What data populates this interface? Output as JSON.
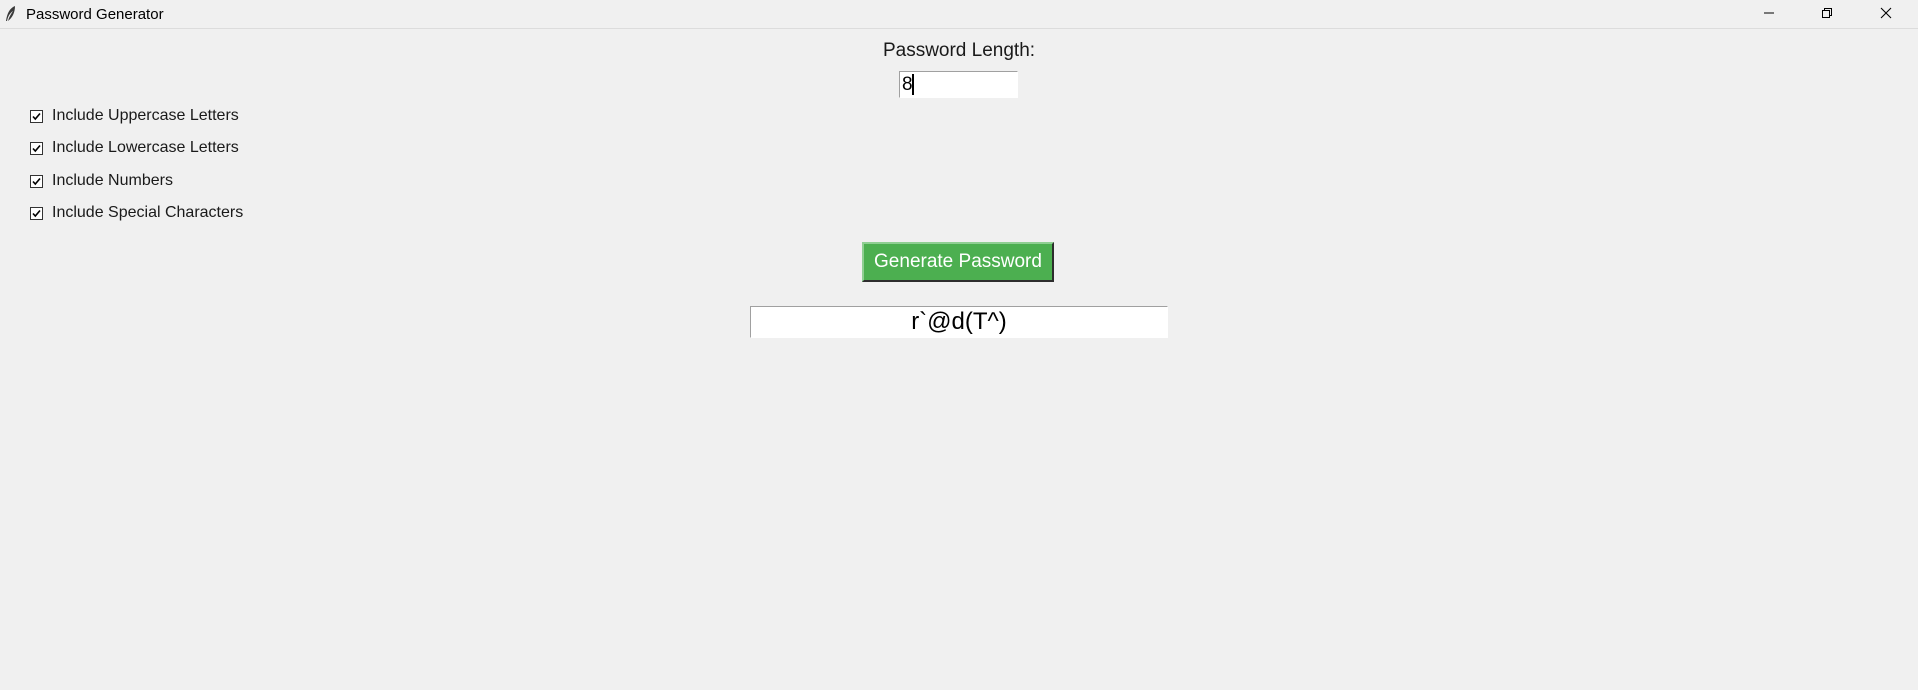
{
  "window": {
    "title": "Password Generator",
    "controls": {
      "minimize_icon": "minimize-icon",
      "maximize_icon": "restore-icon",
      "close_icon": "close-icon"
    }
  },
  "form": {
    "length_label": "Password Length:",
    "length_value": "8",
    "options": [
      {
        "label": "Include Uppercase Letters",
        "checked": true
      },
      {
        "label": "Include Lowercase Letters",
        "checked": true
      },
      {
        "label": "Include Numbers",
        "checked": true
      },
      {
        "label": "Include Special Characters",
        "checked": true
      }
    ],
    "generate_label": "Generate Password",
    "result": "r`@d(T^)"
  },
  "colors": {
    "background": "#f0f0f0",
    "button": "#4caf50",
    "button_text": "#ffffff"
  }
}
